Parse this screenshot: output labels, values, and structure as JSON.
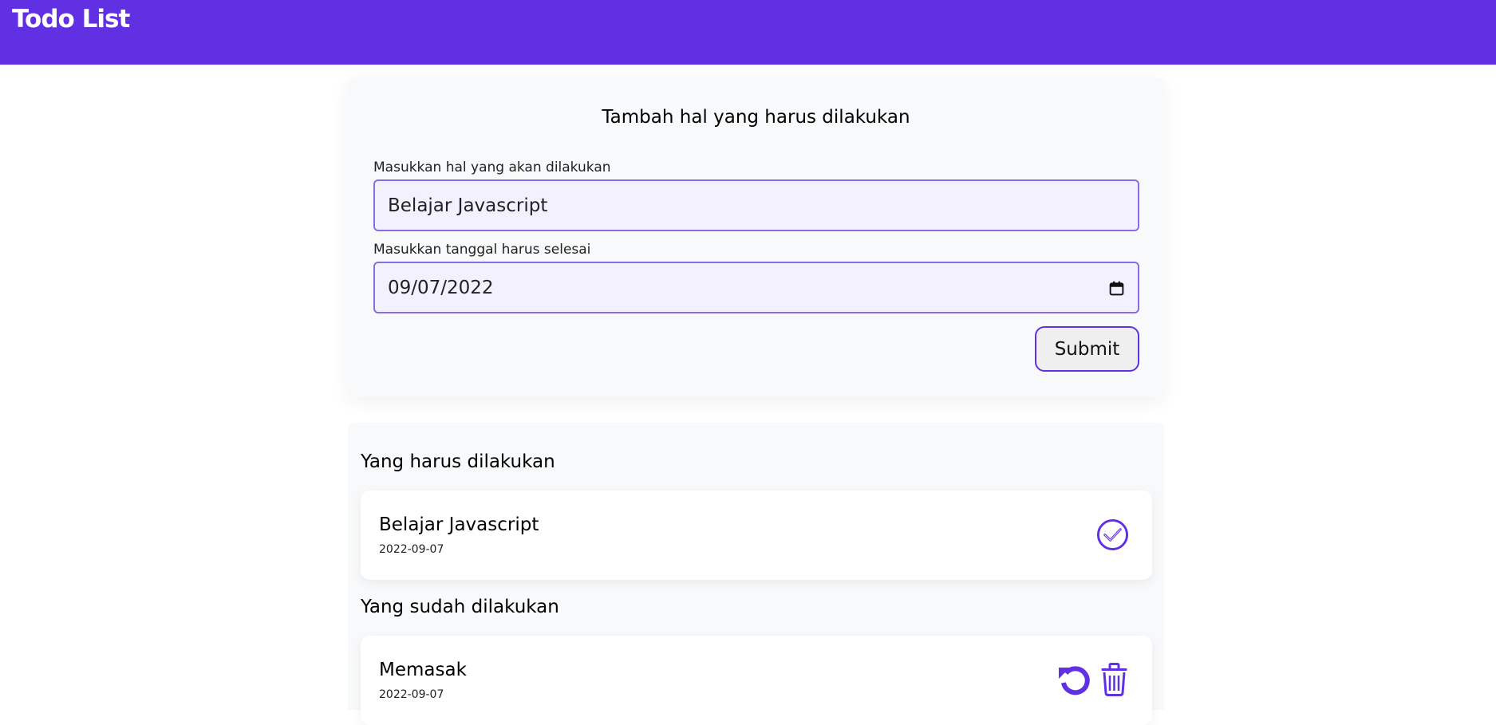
{
  "header": {
    "title": "Todo List"
  },
  "form": {
    "title": "Tambah hal yang harus dilakukan",
    "todo_label": "Masukkan hal yang akan dilakukan",
    "todo_value": "Belajar Javascript",
    "date_label": "Masukkan tanggal harus selesai",
    "date_value": "09/07/2022",
    "submit_label": "Submit"
  },
  "incomplete": {
    "title": "Yang harus dilakukan",
    "items": [
      {
        "title": "Belajar Javascript",
        "date": "2022-09-07"
      }
    ]
  },
  "complete": {
    "title": "Yang sudah dilakukan",
    "items": [
      {
        "title": "Memasak",
        "date": "2022-09-07"
      }
    ]
  },
  "colors": {
    "accent": "#6030e2",
    "input_bg": "#f4f1fe",
    "card_bg": "#f8f9fa"
  },
  "icons": {
    "check": "check-circle-icon",
    "undo": "undo-icon",
    "trash": "trash-icon",
    "calendar": "calendar-icon"
  }
}
